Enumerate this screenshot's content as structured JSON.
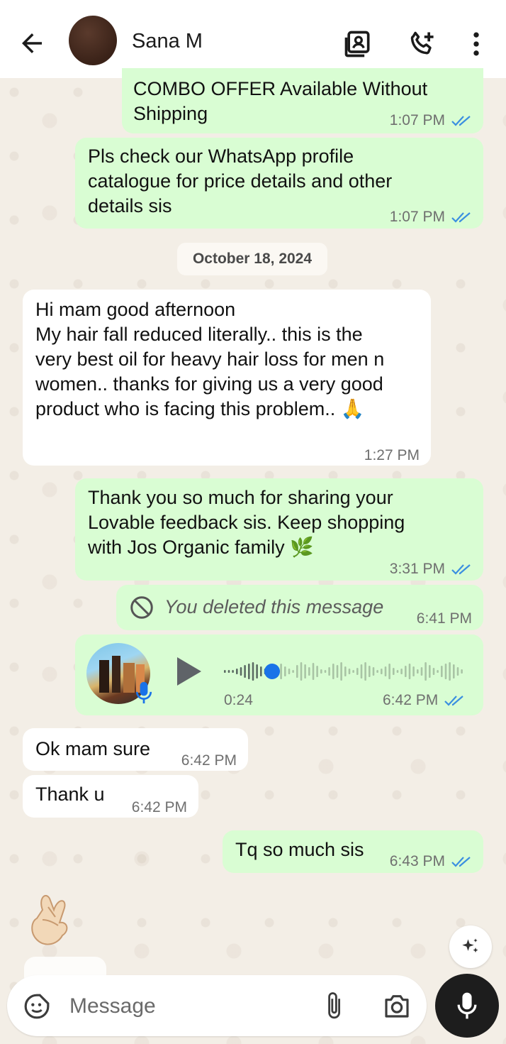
{
  "header": {
    "contact_name": "Sana M",
    "icons": [
      "back-arrow-icon",
      "contact-card-icon",
      "call-add-icon",
      "more-vert-icon"
    ]
  },
  "messages": [
    {
      "dir": "out",
      "text": "COMBO OFFER Available Without\nShipping",
      "time": "1:07 PM",
      "read": true
    },
    {
      "dir": "out",
      "text": "Pls check our WhatsApp profile\ncatalogue for price details and other\ndetails sis",
      "time": "1:07 PM",
      "read": true
    },
    {
      "dir": "in",
      "text": "Hi mam good afternoon\nMy hair fall reduced literally.. this is the\nvery best oil for heavy hair loss for men n\nwomen.. thanks for giving us a very good\nproduct who is facing this problem.. 🙏",
      "time": "1:27 PM"
    },
    {
      "dir": "out",
      "text": "Thank you so much for sharing your\nLovable feedback sis. Keep shopping\nwith Jos Organic family 🌿",
      "time": "3:31 PM",
      "read": true
    },
    {
      "dir": "out",
      "deleted": true,
      "text": "You deleted this message",
      "time": "6:41 PM"
    },
    {
      "dir": "out",
      "voice": true,
      "duration": "0:24",
      "progress": 0.2,
      "time": "6:42 PM",
      "read": true
    },
    {
      "dir": "in",
      "text": "Ok mam sure",
      "time": "6:42 PM"
    },
    {
      "dir": "in",
      "text": "Thank u",
      "time": "6:42 PM"
    },
    {
      "dir": "out",
      "text": "Tq so much sis",
      "time": "6:43 PM",
      "read": true
    },
    {
      "dir": "in",
      "emoji": "🤞"
    }
  ],
  "date_chip": "October 18, 2024",
  "composer": {
    "placeholder": "Message"
  },
  "colors": {
    "outgoing_bubble": "#d9fdd3",
    "incoming_bubble": "#ffffff",
    "read_ticks": "#3b8fe0",
    "voice_progress": "#1a73e8"
  }
}
